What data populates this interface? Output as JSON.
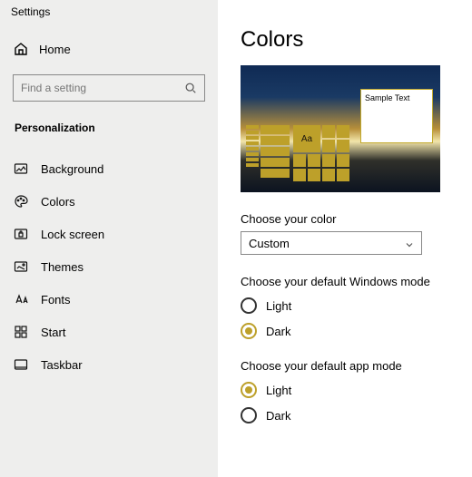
{
  "app": {
    "title": "Settings"
  },
  "sidebar": {
    "home_label": "Home",
    "search_placeholder": "Find a setting",
    "category": "Personalization",
    "items": [
      {
        "label": "Background"
      },
      {
        "label": "Colors"
      },
      {
        "label": "Lock screen"
      },
      {
        "label": "Themes"
      },
      {
        "label": "Fonts"
      },
      {
        "label": "Start"
      },
      {
        "label": "Taskbar"
      }
    ]
  },
  "main": {
    "title": "Colors",
    "preview": {
      "sample_text": "Sample Text",
      "accent_sample": "Aa",
      "accent_color": "#bda02a"
    },
    "color_mode": {
      "label": "Choose your color",
      "selected": "Custom"
    },
    "windows_mode": {
      "label": "Choose your default Windows mode",
      "options": [
        {
          "label": "Light",
          "selected": false
        },
        {
          "label": "Dark",
          "selected": true
        }
      ]
    },
    "app_mode": {
      "label": "Choose your default app mode",
      "options": [
        {
          "label": "Light",
          "selected": true
        },
        {
          "label": "Dark",
          "selected": false
        }
      ]
    }
  }
}
